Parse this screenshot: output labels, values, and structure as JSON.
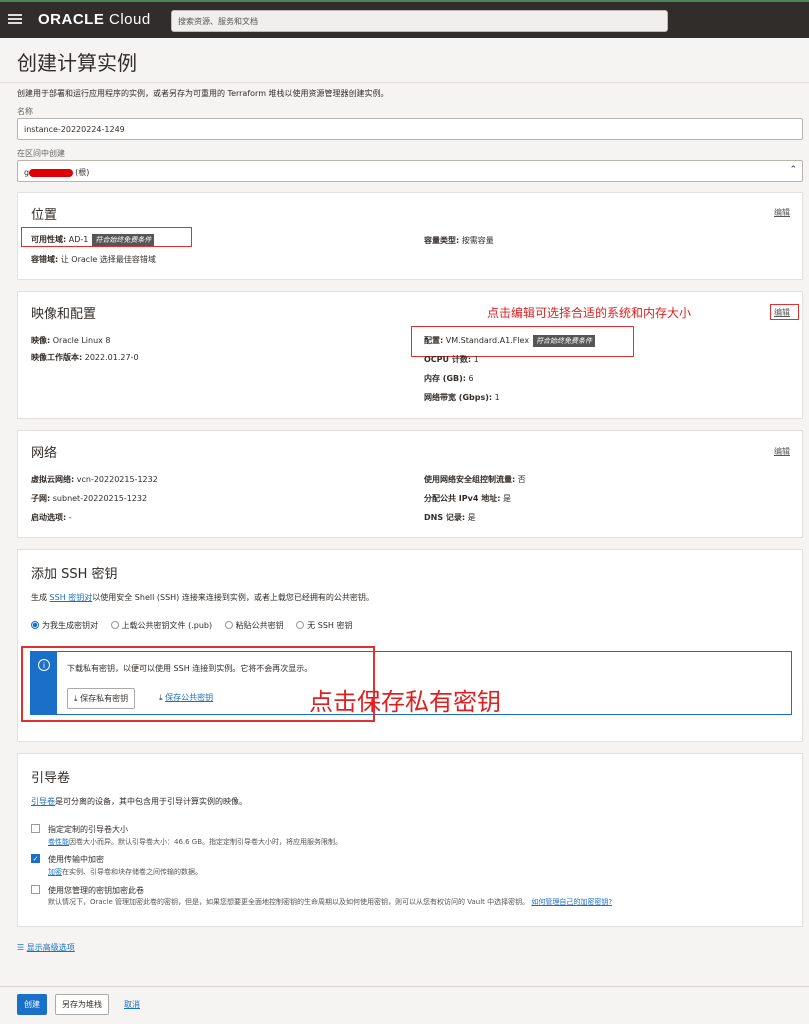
{
  "topbar": {
    "brand_bold": "ORACLE",
    "brand_light": " Cloud",
    "search_placeholder": "搜索资源、服务和文档"
  },
  "page": {
    "title": "创建计算实例",
    "description": "创建用于部署和运行应用程序的实例，或者另存为可重用的 Terraform 堆栈以使用资源管理器创建实例。"
  },
  "form": {
    "name_label": "名称",
    "name_value": "instance-20220224-1249",
    "compartment_label": "在区间中创建",
    "compartment_prefix": "g",
    "compartment_suffix": "(根)"
  },
  "placement": {
    "title": "位置",
    "edit": "编辑",
    "ad_key": "可用性域:",
    "ad_value": "AD-1",
    "ad_badge": "符合始终免费条件",
    "fault_key": "容错域:",
    "fault_value": "让 Oracle 选择最佳容错域",
    "capacity_key": "容量类型:",
    "capacity_value": "按需容量"
  },
  "image": {
    "title": "映像和配置",
    "edit": "编辑",
    "annotation": "点击编辑可选择合适的系统和内存大小",
    "image_key": "映像:",
    "image_value": "Oracle Linux 8",
    "build_key": "映像工作版本:",
    "build_value": "2022.01.27-0",
    "shape_key": "配置:",
    "shape_value": "VM.Standard.A1.Flex",
    "shape_badge": "符合始终免费条件",
    "ocpu_key": "OCPU 计数:",
    "ocpu_value": "1",
    "memory_key": "内存 (GB):",
    "memory_value": "6",
    "bandwidth_key": "网络带宽 (Gbps):",
    "bandwidth_value": "1"
  },
  "network": {
    "title": "网络",
    "edit": "编辑",
    "vcn_key": "虚拟云网络:",
    "vcn_value": "vcn-20220215-1232",
    "subnet_key": "子网:",
    "subnet_value": "subnet-20220215-1232",
    "launch_key": "启动选项:",
    "launch_value": "-",
    "nsg_key": "使用网络安全组控制流量:",
    "nsg_value": "否",
    "ipv4_key": "分配公共 IPv4 地址:",
    "ipv4_value": "是",
    "dns_key": "DNS 记录:",
    "dns_value": "是"
  },
  "ssh": {
    "title": "添加 SSH 密钥",
    "desc_pre": "生成 ",
    "desc_link": "SSH 密钥对",
    "desc_post": "以使用安全 Shell (SSH) 连接来连接到实例，或者上载您已经拥有的公共密钥。",
    "radio_generate": "为我生成密钥对",
    "radio_upload": "上载公共密钥文件 (.pub)",
    "radio_paste": "粘贴公共密钥",
    "radio_none": "无 SSH 密钥",
    "info_text": "下载私有密钥，以便可以使用 SSH 连接到实例。它将不会再次显示。",
    "save_private": "保存私有密钥",
    "save_public": "保存公共密钥",
    "annotation": "点击保存私有密钥"
  },
  "boot": {
    "title": "引导卷",
    "desc_link": "引导卷",
    "desc_post": "是可分离的设备，其中包含用于引导计算实例的映像。",
    "opt1_label": "指定定制的引导卷大小",
    "opt1_help_link": "卷性能",
    "opt1_help": "因卷大小而异。默认引导卷大小：46.6 GB。指定定制引导卷大小时，将应用服务限制。",
    "opt2_label": "使用传输中加密",
    "opt2_help_link": "加密",
    "opt2_help": "在实例、引导卷和块存储卷之间传输的数据。",
    "opt3_label": "使用您管理的密钥加密此卷",
    "opt3_help": "默认情况下，Oracle 管理加密此卷的密钥，但是，如果您想要更全面地控制密钥的生命周期以及如何使用密钥，则可以从您有权访问的 Vault 中选择密钥。",
    "opt3_help_link": "如何管理自己的加密密钥?"
  },
  "advanced": {
    "link": "显示高级选项"
  },
  "footer": {
    "create": "创建",
    "save_stack": "另存为堆栈",
    "cancel": "取消"
  }
}
